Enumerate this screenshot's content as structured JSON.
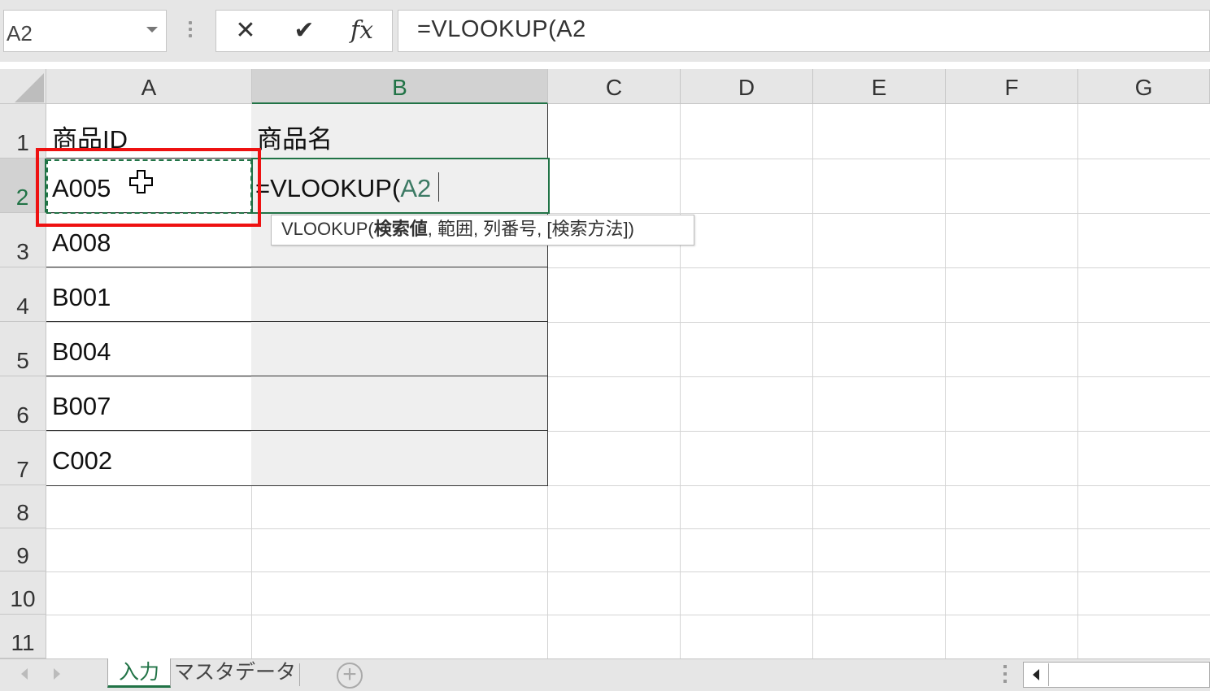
{
  "formula_bar": {
    "name_box": "A2",
    "cancel_glyph": "✕",
    "enter_glyph": "✔",
    "fx_label": "fx",
    "formula": "=VLOOKUP(A2"
  },
  "columns": [
    "A",
    "B",
    "C",
    "D",
    "E",
    "F",
    "G"
  ],
  "selected_column": "B",
  "rows": [
    "1",
    "2",
    "3",
    "4",
    "5",
    "6",
    "7",
    "8",
    "9",
    "10",
    "11"
  ],
  "selected_row": "2",
  "cells": {
    "A1": "商品ID",
    "B1": "商品名",
    "A2": "A005",
    "B2_prefix": "=VLOOKUP(",
    "B2_ref": "A2",
    "A3": "A008",
    "A4": "B001",
    "A5": "B004",
    "A6": "B007",
    "A7": "C002"
  },
  "tooltip": {
    "func": "VLOOKUP(",
    "arg_bold": "検索値",
    "rest": ", 範囲, 列番号, [検索方法])"
  },
  "sheet_tabs": [
    "入力",
    "マスタデータ"
  ],
  "active_sheet": "入力",
  "icons": {
    "namebox_dropdown": "chevron-down-icon",
    "cancel": "close-icon",
    "enter": "check-icon",
    "insert_function": "fx-icon",
    "add_sheet": "plus-circle-icon",
    "cursor": "cell-select-cross-cursor-icon"
  },
  "colors": {
    "accent_green": "#217346",
    "highlight_red": "#ee1111",
    "table_bg": "#efefef"
  }
}
